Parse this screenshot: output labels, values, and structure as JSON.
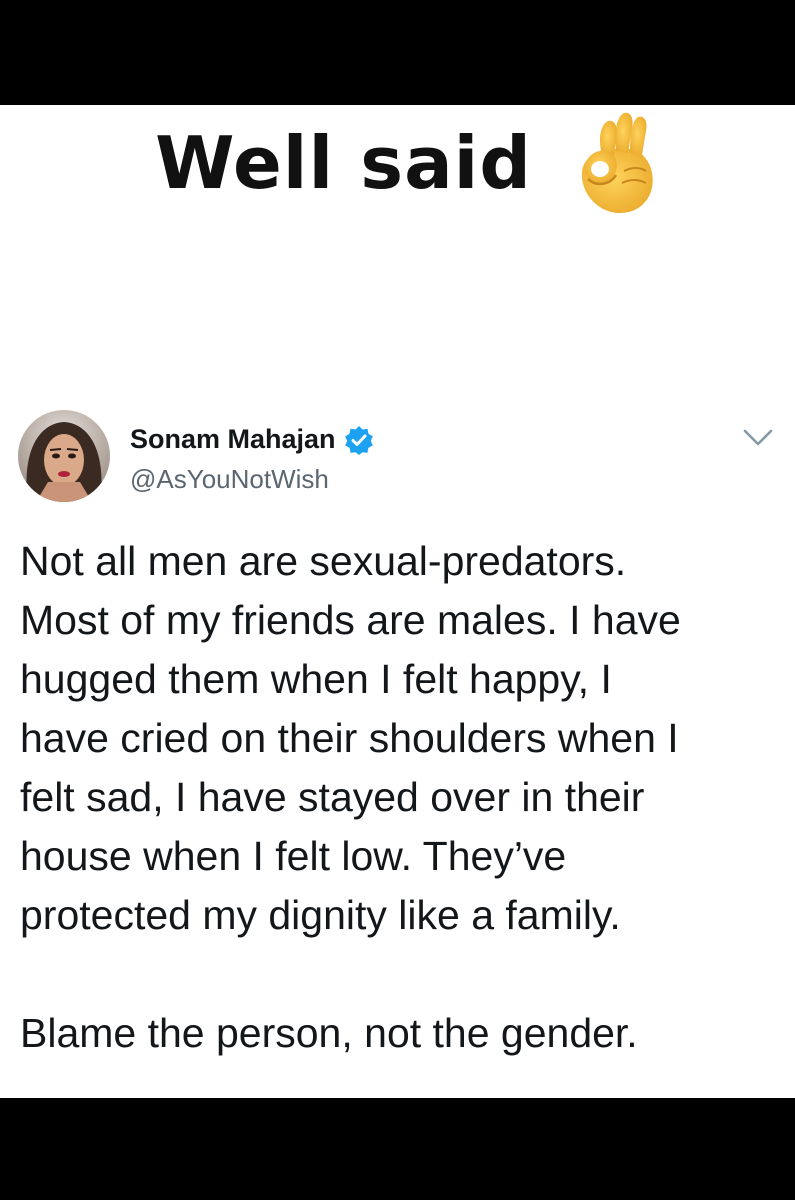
{
  "headline": {
    "text": "Well said",
    "emoji_icon": "ok-hand-emoji"
  },
  "tweet": {
    "author": {
      "display_name": "Sonam Mahajan",
      "handle": "@AsYouNotWish",
      "verified": true,
      "avatar_icon": "profile-photo"
    },
    "menu_icon": "chevron-down-icon",
    "body": {
      "lines": [
        "Not all men are sexual-predators.",
        "Most of my friends are males. I have",
        "hugged them when I felt happy, I",
        "have cried on their shoulders when I",
        "felt sad, I have stayed over in their",
        "house when I felt low. They’ve",
        "protected my dignity like a family."
      ],
      "closing": "Blame the person, not the gender."
    }
  },
  "colors": {
    "frame": "#000000",
    "card_background": "#ffffff",
    "text_primary": "#14171a",
    "text_secondary": "#5b6670",
    "verified_badge": "#1da1f2",
    "emoji": "#f6c443"
  }
}
